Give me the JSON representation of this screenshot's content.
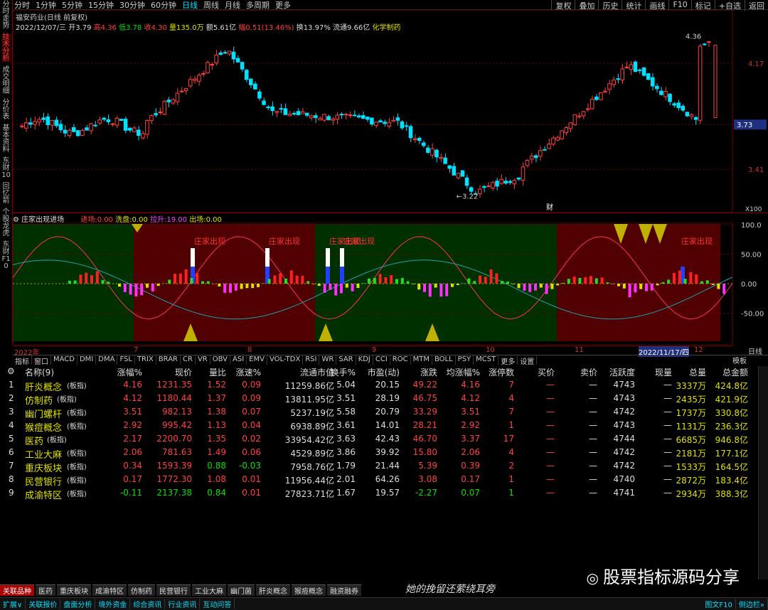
{
  "toolbar": {
    "periods": [
      "分时",
      "1分钟",
      "5分钟",
      "15分钟",
      "30分钟",
      "60分钟",
      "日线",
      "周线",
      "月线",
      "多周期",
      "更多"
    ],
    "active_period": "日线",
    "tools": [
      "复权",
      "叠加",
      "历史",
      "统计",
      "画线",
      "F10",
      "标记",
      "+自选",
      "返回"
    ]
  },
  "side_tabs": [
    "分时走势",
    "技术分析",
    "成交明细",
    "分价表",
    "基本资料",
    "东财10",
    "回忆箭",
    "个股龙虎",
    "东财F10"
  ],
  "stock": {
    "title": "福安药业(日线 前复权)",
    "date": "2022/12/07/三",
    "open_label": "开",
    "open": "3.79",
    "high_label": "高",
    "high": "4.36",
    "low_label": "低",
    "low": "3.78",
    "close_label": "收",
    "close": "4.30",
    "volume_label": "量",
    "volume": "135.0万",
    "amount_label": "额",
    "amount": "5.61亿",
    "amp_label": "幅",
    "amp": "0.51(13.46%)",
    "turnover_label": "换",
    "turnover": "13.97%",
    "float_label": "流通",
    "float": "9.66亿",
    "sector": "化学制药"
  },
  "price_axis": {
    "high": "4.36",
    "low": "3.22",
    "labels": [
      "4.17",
      "3.73",
      "3.41"
    ],
    "x_label": "X100",
    "finance_badge": "财"
  },
  "indicator": {
    "name": "庄家出现进场",
    "enter_label": "进场:",
    "enter": "0.00",
    "wash_label": "洗盘:",
    "wash": "0.00",
    "pull_label": "拉升:",
    "pull": "19.00",
    "exit_label": "出场:",
    "exit": "0.00",
    "axis": [
      "100.0",
      "50.00",
      "0.00",
      "-50.00"
    ],
    "signal_text": "庄家出现"
  },
  "date_bar": [
    "2022年",
    "7",
    "8",
    "9",
    "10",
    "11",
    "12"
  ],
  "date_highlight": "2022/11/17/四",
  "date_right": "日线",
  "ind_tabs": [
    "指标",
    "窗口",
    "MACD",
    "DMI",
    "DMA",
    "FSL",
    "TRIX",
    "BRAR",
    "CR",
    "VR",
    "OBV",
    "ASI",
    "EMV",
    "VOL-TDX",
    "RSI",
    "WR",
    "SAR",
    "KDJ",
    "CCI",
    "ROC",
    "MTM",
    "BOLL",
    "PSY",
    "MCST",
    "更多",
    "设置"
  ],
  "ind_tab_right": "模板",
  "table": {
    "headers": [
      "名称(9)",
      "涨幅%",
      "现价",
      "量比",
      "涨速%",
      "流通市值",
      "换手%",
      "市盈(动)",
      "涨跌",
      "均涨幅%",
      "涨停数",
      "买价",
      "卖价",
      "活跃度",
      "现量",
      "总量",
      "总金额"
    ],
    "rows": [
      [
        "1",
        "肝炎概念",
        "(板指)",
        "4.16",
        "1231.35",
        "1.52",
        "0.09",
        "11259.86亿",
        "5.04",
        "20.15",
        "49.22",
        "4.16",
        "7",
        "—",
        "—",
        "4743",
        "—",
        "3337万",
        "424.8亿"
      ],
      [
        "2",
        "仿制药",
        "(板指)",
        "4.12",
        "1180.44",
        "1.37",
        "0.09",
        "13811.95亿",
        "3.51",
        "28.19",
        "46.75",
        "4.12",
        "4",
        "—",
        "—",
        "4743",
        "—",
        "2435万",
        "421.9亿"
      ],
      [
        "3",
        "幽门螺杆",
        "(板指)",
        "3.51",
        "982.13",
        "1.38",
        "0.07",
        "5237.19亿",
        "5.58",
        "20.79",
        "33.29",
        "3.51",
        "7",
        "—",
        "—",
        "4742",
        "—",
        "1737万",
        "330.8亿"
      ],
      [
        "4",
        "猴痘概念",
        "(板指)",
        "2.92",
        "995.42",
        "1.13",
        "0.04",
        "6938.89亿",
        "3.61",
        "14.01",
        "28.21",
        "2.92",
        "1",
        "—",
        "—",
        "4743",
        "—",
        "1131万",
        "236.3亿"
      ],
      [
        "5",
        "医药",
        "(板指)",
        "2.17",
        "2200.70",
        "1.35",
        "0.02",
        "33954.42亿",
        "3.63",
        "42.43",
        "46.70",
        "3.37",
        "17",
        "—",
        "—",
        "4744",
        "—",
        "6685万",
        "946.8亿"
      ],
      [
        "6",
        "工业大麻",
        "(板指)",
        "2.06",
        "781.63",
        "1.49",
        "0.06",
        "4529.89亿",
        "3.86",
        "39.92",
        "15.80",
        "2.06",
        "4",
        "—",
        "—",
        "4742",
        "—",
        "2181万",
        "177.1亿"
      ],
      [
        "7",
        "重庆板块",
        "(板指)",
        "0.34",
        "1593.39",
        "0.88",
        "-0.03",
        "7958.76亿",
        "1.79",
        "21.44",
        "5.39",
        "0.39",
        "2",
        "—",
        "—",
        "4742",
        "—",
        "1533万",
        "164.5亿"
      ],
      [
        "8",
        "民营银行",
        "(板指)",
        "0.17",
        "1772.30",
        "1.08",
        "0.01",
        "11956.44亿",
        "2.01",
        "64.26",
        "3.08",
        "0.17",
        "1",
        "—",
        "—",
        "4740",
        "—",
        "2872万",
        "183.4亿"
      ],
      [
        "9",
        "成渝特区",
        "(板指)",
        "-0.11",
        "2137.38",
        "0.84",
        "0.01",
        "27823.71亿",
        "1.67",
        "19.57",
        "-2.27",
        "0.07",
        "1",
        "—",
        "—",
        "4741",
        "—",
        "2934万",
        "388.3亿"
      ]
    ]
  },
  "block_tabs": [
    "关联品种",
    "医药",
    "重庆板块",
    "成渝特区",
    "仿制药",
    "民营银行",
    "工业大麻",
    "幽门菌",
    "肝炎概念",
    "猴痘概念",
    "融资融券"
  ],
  "status_bar": [
    "扩展∨",
    "关联报价",
    "盘面分析",
    "境外资金",
    "综合资讯",
    "行业资讯",
    "互动问答"
  ],
  "status_right": [
    "图文F10",
    "侧边栏»"
  ],
  "handwriting": "她的挽留还萦绕耳旁",
  "watermark": "股票指标源码分享",
  "colors": {
    "up": "#ff4040",
    "down": "#00e0ff",
    "green_zone": "#003000",
    "red_zone": "#500000"
  }
}
